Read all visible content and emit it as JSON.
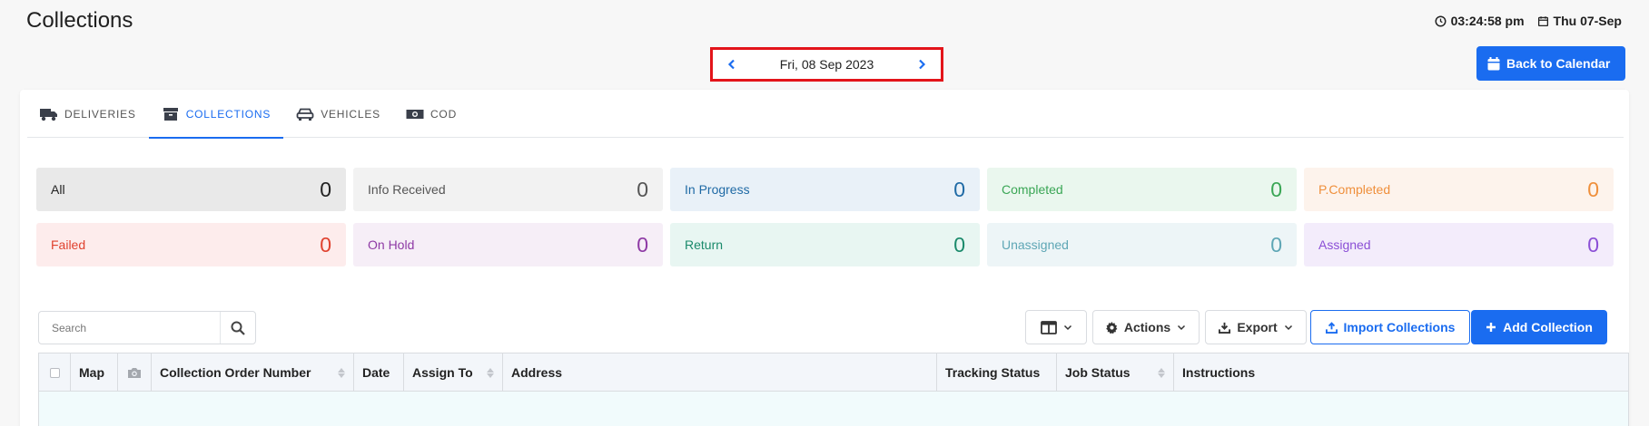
{
  "header": {
    "title": "Collections",
    "time": "03:24:58 pm",
    "date": "Thu 07-Sep",
    "time_icon": "clock-icon",
    "date_icon": "calendar-icon"
  },
  "date_nav": {
    "label": "Fri, 08 Sep 2023",
    "prev_icon": "chevron-left-icon",
    "next_icon": "chevron-right-icon"
  },
  "back_button": {
    "label": "Back to Calendar",
    "icon": "calendar-icon"
  },
  "tabs": [
    {
      "label": "DELIVERIES",
      "icon": "truck-icon",
      "active": false
    },
    {
      "label": "COLLECTIONS",
      "icon": "archive-icon",
      "active": true
    },
    {
      "label": "VEHICLES",
      "icon": "car-icon",
      "active": false
    },
    {
      "label": "COD",
      "icon": "money-icon",
      "active": false
    }
  ],
  "status_tiles": [
    {
      "label": "All",
      "count": "0",
      "bg": "#e9e9e9",
      "color": "#222222"
    },
    {
      "label": "Info Received",
      "count": "0",
      "bg": "#f2f2f2",
      "color": "#555555"
    },
    {
      "label": "In Progress",
      "count": "0",
      "bg": "#e9f1f8",
      "color": "#1f6aa5"
    },
    {
      "label": "Completed",
      "count": "0",
      "bg": "#eaf7ee",
      "color": "#3aa655"
    },
    {
      "label": "P.Completed",
      "count": "0",
      "bg": "#fdf3ec",
      "color": "#ef8f3b"
    },
    {
      "label": "Failed",
      "count": "0",
      "bg": "#fdecec",
      "color": "#e0422f"
    },
    {
      "label": "On Hold",
      "count": "0",
      "bg": "#f6eef7",
      "color": "#8e3aa5"
    },
    {
      "label": "Return",
      "count": "0",
      "bg": "#e8f6f2",
      "color": "#1a8a6b"
    },
    {
      "label": "Unassigned",
      "count": "0",
      "bg": "#edf5f7",
      "color": "#5ea6b5"
    },
    {
      "label": "Assigned",
      "count": "0",
      "bg": "#f3ecfb",
      "color": "#8b4fd6"
    }
  ],
  "toolbar": {
    "search_placeholder": "Search",
    "search_icon": "search-icon",
    "columns_icon": "columns-icon",
    "actions_label": "Actions",
    "actions_icon": "gear-icon",
    "export_label": "Export",
    "export_icon": "download-icon",
    "import_label": "Import Collections",
    "import_icon": "upload-icon",
    "add_label": "Add Collection",
    "add_icon": "plus-icon"
  },
  "table": {
    "columns": [
      {
        "label": "",
        "kind": "checkbox"
      },
      {
        "label": "Map",
        "sortable": false
      },
      {
        "label": "",
        "kind": "camera"
      },
      {
        "label": "Collection Order Number",
        "sortable": true
      },
      {
        "label": "Date",
        "sortable": false
      },
      {
        "label": "Assign To",
        "sortable": true
      },
      {
        "label": "Address",
        "sortable": false
      },
      {
        "label": "Tracking Status",
        "sortable": false
      },
      {
        "label": "Job Status",
        "sortable": true
      },
      {
        "label": "Instructions",
        "sortable": false
      }
    ],
    "rows": []
  },
  "colors": {
    "accent": "#1a6cf0",
    "highlight_border": "#e3141a"
  }
}
